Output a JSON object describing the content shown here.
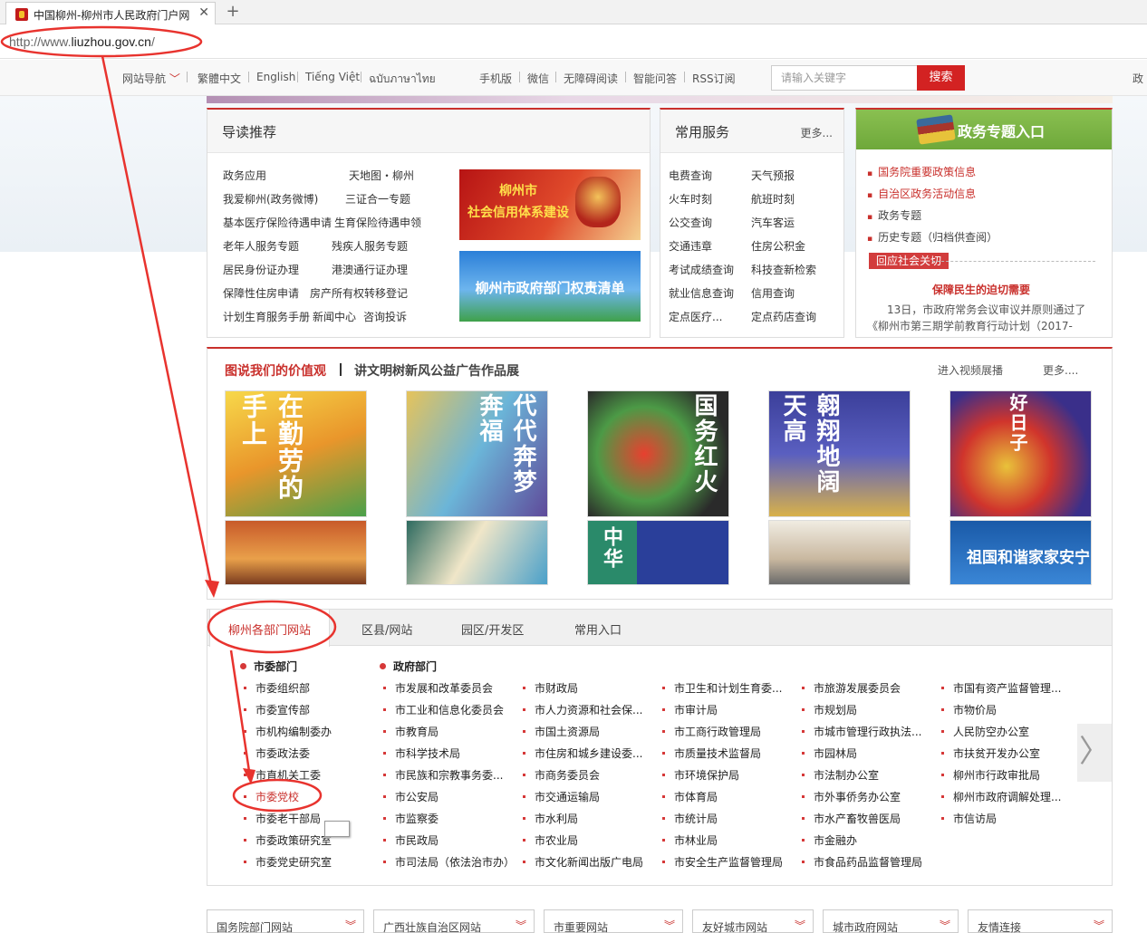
{
  "browser": {
    "tab_title": "中国柳州-柳州市人民政府门户网",
    "tab_close": "✕",
    "new_tab": "+",
    "address_prefix": "http://www.",
    "address_domain": "liuzhou.gov.cn",
    "address_suffix": "/"
  },
  "topnav": {
    "site_nav": "网站导航",
    "lang1": "繁體中文",
    "lang2": "English",
    "lang3": "Tiếng Việt",
    "lang4": "ฉบับภาษาไทย",
    "mobile": "手机版",
    "wechat": "微信",
    "accessible": "无障碍阅读",
    "qa": "智能问答",
    "rss": "RSS订阅",
    "search_placeholder": "请输入关键字",
    "search_button": "搜索",
    "right_cut": "政"
  },
  "guide": {
    "title": "导读推荐",
    "left_col": [
      "政务应用",
      "我爱柳州(政务微博)",
      "基本医疗保险待遇申请",
      "老年人服务专题",
      "居民身份证办理",
      "保障性住房申请",
      "计划生育服务手册"
    ],
    "right_col": [
      "天地图・柳州",
      "三证合一专题",
      "生育保险待遇申领",
      "残疾人服务专题",
      "港澳通行证办理",
      "房产所有权转移登记",
      "新闻中心"
    ],
    "extra": "咨询投诉",
    "promo1_line1": "柳州市",
    "promo1_line2": "社会信用体系建设",
    "promo2": "柳州市政府部门权责清单"
  },
  "services": {
    "title": "常用服务",
    "more": "更多...",
    "col1": [
      "电费查询",
      "火车时刻",
      "公交查询",
      "交通违章",
      "考试成绩查询",
      "就业信息查询",
      "定点医疗..."
    ],
    "col2": [
      "天气预报",
      "航班时刻",
      "汽车客运",
      "住房公积金",
      "科技查新检索",
      "信用查询",
      "定点药店查询"
    ]
  },
  "gov_topics": {
    "title": "政务专题入口",
    "items": [
      "国务院重要政策信息",
      "自治区政务活动信息",
      "政务专题",
      "历史专题（归档供查阅）"
    ],
    "button": "回应社会关切",
    "headline": "保障民生的迫切需要",
    "summary1": "13日，市政府常务会议审议并原则通过了",
    "summary2": "《柳州市第三期学前教育行动计划（2017-"
  },
  "values": {
    "title1": "图说我们的价值观",
    "title2": "讲文明树新风公益广告作品展",
    "video": "进入视频展播",
    "more": "更多....",
    "posters_top": [
      "在勤劳的手上",
      "代代奔梦奔福",
      "国务红火",
      "翱翔地阔天高",
      "好日子"
    ],
    "posters_bottom": [
      "",
      "",
      "中华",
      "",
      "祖国和谐家家安宁"
    ]
  },
  "depts": {
    "tabs": [
      "柳州各部门网站",
      "区县/网站",
      "园区/开发区",
      "常用入口"
    ],
    "group1": "市委部门",
    "group2": "政府部门",
    "col0": [
      "市委组织部",
      "市委宣传部",
      "市机构编制委办",
      "市委政法委",
      "市直机关工委",
      "市委党校",
      "市委老干部局",
      "市委政策研究室",
      "市委党史研究室"
    ],
    "col1": [
      "市发展和改革委员会",
      "市工业和信息化委员会",
      "市教育局",
      "市科学技术局",
      "市民族和宗教事务委...",
      "市公安局",
      "市监察委",
      "市民政局",
      "市司法局（依法治市办）"
    ],
    "col2": [
      "市财政局",
      "市人力资源和社会保...",
      "市国土资源局",
      "市住房和城乡建设委...",
      "市商务委员会",
      "市交通运输局",
      "市水利局",
      "市农业局",
      "市文化新闻出版广电局"
    ],
    "col3": [
      "市卫生和计划生育委...",
      "市审计局",
      "市工商行政管理局",
      "市质量技术监督局",
      "市环境保护局",
      "市体育局",
      "市统计局",
      "市林业局",
      "市安全生产监督管理局"
    ],
    "col4": [
      "市旅游发展委员会",
      "市规划局",
      "市城市管理行政执法...",
      "市园林局",
      "市法制办公室",
      "市外事侨务办公室",
      "市水产畜牧兽医局",
      "市金融办",
      "市食品药品监督管理局"
    ],
    "col5": [
      "市国有资产监督管理...",
      "市物价局",
      "人民防空办公室",
      "市扶贫开发办公室",
      "柳州市行政审批局",
      "柳州市政府调解处理...",
      "市信访局"
    ],
    "next": "〉"
  },
  "footer_dd": [
    "国务院部门网站",
    "广西壮族自治区网站",
    "市重要网站",
    "友好城市网站",
    "城市政府网站",
    "友情连接"
  ],
  "colors": {
    "brand_red": "#c9302c",
    "annotation_red": "#e8332e",
    "topic_green": "#7ab243"
  }
}
